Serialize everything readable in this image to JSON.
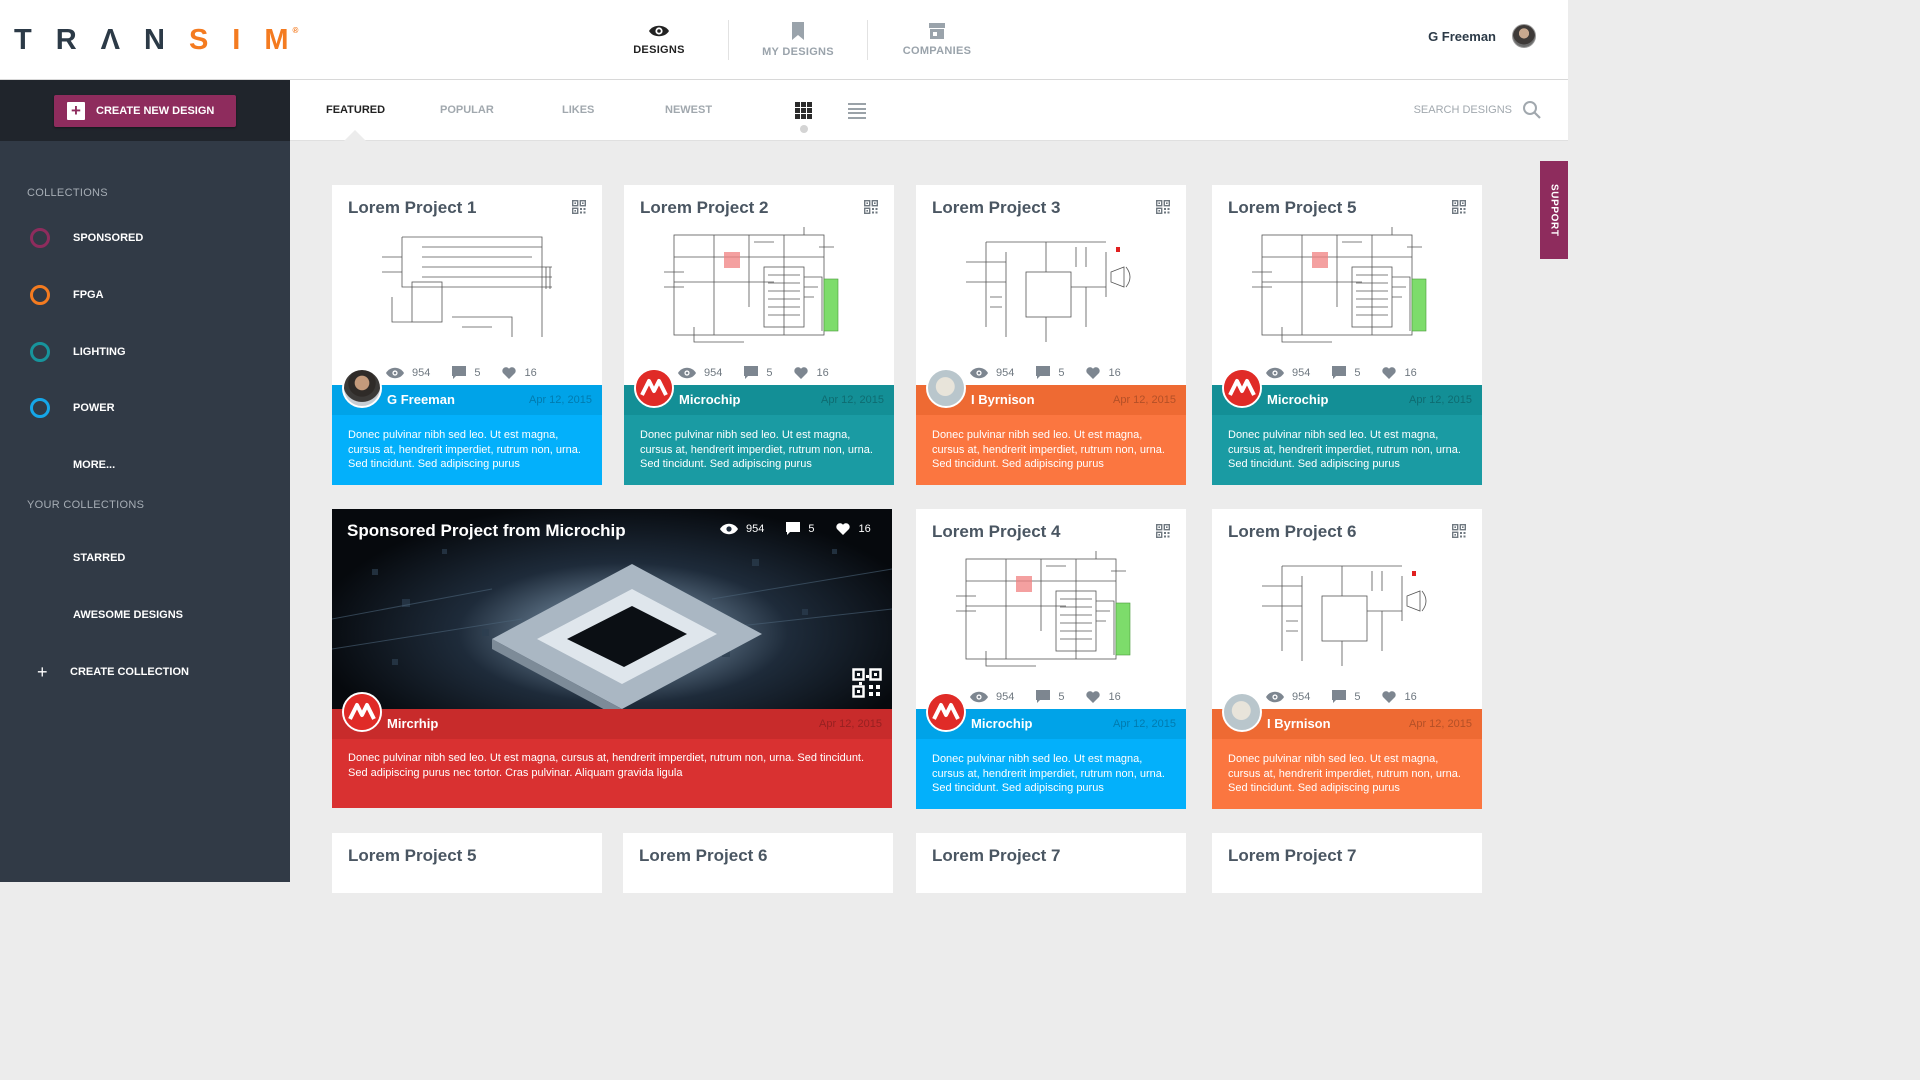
{
  "brand": {
    "prefix": "TR",
    "mid": "ΛN",
    "accent": "SIM",
    "mark": "®"
  },
  "nav": [
    {
      "label": "DESIGNS",
      "icon": "eye-icon",
      "active": true
    },
    {
      "label": "MY DESIGNS",
      "icon": "bookmark-icon",
      "active": false
    },
    {
      "label": "COMPANIES",
      "icon": "store-icon",
      "active": false
    }
  ],
  "user": {
    "name": "G Freeman"
  },
  "sidebar": {
    "create_button": "CREATE NEW DESIGN",
    "collections_heading": "COLLECTIONS",
    "collections": [
      {
        "label": "SPONSORED",
        "color": "#8e2c5d"
      },
      {
        "label": "FPGA",
        "color": "#f47b20"
      },
      {
        "label": "LIGHTING",
        "color": "#17949c"
      },
      {
        "label": "POWER",
        "color": "#15a6e8"
      }
    ],
    "more": "MORE...",
    "your_collections_heading": "YOUR COLLECTIONS",
    "your_collections": [
      "STARRED",
      "AWESOME DESIGNS"
    ],
    "create_collection": "CREATE COLLECTION"
  },
  "toolbar": {
    "tabs": [
      "FEATURED",
      "POPULAR",
      "LIKES",
      "NEWEST"
    ],
    "active_tab": "FEATURED",
    "search_placeholder": "SEARCH DESIGNS"
  },
  "support": "SUPPORT",
  "cards": [
    {
      "title": "Lorem Project 1",
      "views": "954",
      "comments": "5",
      "likes": "16",
      "author": "G Freeman",
      "avatar": "person",
      "date": "Apr 12, 2015",
      "band_color": "#00a3e8",
      "desc_color": "#03b0fb",
      "desc": "Donec pulvinar nibh sed leo. Ut est magna, cursus at, hendrerit imperdiet, rutrum non, urna. Sed tincidunt. Sed adipiscing purus"
    },
    {
      "title": "Lorem Project 2",
      "views": "954",
      "comments": "5",
      "likes": "16",
      "author": "Microchip",
      "avatar": "microchip",
      "date": "Apr 12, 2015",
      "band_color": "#138f96",
      "desc_color": "#1a9ba3",
      "desc": "Donec pulvinar nibh sed leo. Ut est magna, cursus at, hendrerit imperdiet, rutrum non, urna. Sed tincidunt. Sed adipiscing purus"
    },
    {
      "title": "Lorem Project 3",
      "views": "954",
      "comments": "5",
      "likes": "16",
      "author": "I Byrnison",
      "avatar": "bear",
      "date": "Apr 12, 2015",
      "band_color": "#ee6a33",
      "desc_color": "#fb7640",
      "desc": "Donec pulvinar nibh sed leo. Ut est magna, cursus at, hendrerit imperdiet, rutrum non, urna. Sed tincidunt. Sed adipiscing purus"
    },
    {
      "title": "Lorem Project 5",
      "views": "954",
      "comments": "5",
      "likes": "16",
      "author": "Microchip",
      "avatar": "microchip",
      "date": "Apr 12, 2015",
      "band_color": "#138f96",
      "desc_color": "#1a9ba3",
      "desc": "Donec pulvinar nibh sed leo. Ut est magna, cursus at, hendrerit imperdiet, rutrum non, urna. Sed tincidunt. Sed adipiscing purus"
    },
    {
      "title": "Lorem Project 4",
      "views": "954",
      "comments": "5",
      "likes": "16",
      "author": "Microchip",
      "avatar": "microchip",
      "date": "Apr 12, 2015",
      "band_color": "#00a3e8",
      "desc_color": "#03b0fb",
      "desc": "Donec pulvinar nibh sed leo. Ut est magna, cursus at, hendrerit imperdiet, rutrum non, urna. Sed tincidunt. Sed adipiscing purus"
    },
    {
      "title": "Lorem Project 6",
      "views": "954",
      "comments": "5",
      "likes": "16",
      "author": "I Byrnison",
      "avatar": "bear",
      "date": "Apr 12, 2015",
      "band_color": "#ee6a33",
      "desc_color": "#fb7640",
      "desc": "Donec pulvinar nibh sed leo. Ut est magna, cursus at, hendrerit imperdiet, rutrum non, urna. Sed tincidunt. Sed adipiscing purus"
    }
  ],
  "sponsored": {
    "title": "Sponsored Project from Microchip",
    "views": "954",
    "comments": "5",
    "likes": "16",
    "author": "Mircrhip",
    "date": "Apr 12, 2015",
    "desc": "Donec pulvinar nibh sed leo. Ut est magna, cursus at, hendrerit imperdiet, rutrum non, urna. Sed tincidunt. Sed adipiscing purus nec tortor. Cras pulvinar. Aliquam gravida ligula"
  },
  "bottom_cards": [
    "Lorem Project 5",
    "Lorem Project 6",
    "Lorem Project 7",
    "Lorem Project 7"
  ]
}
